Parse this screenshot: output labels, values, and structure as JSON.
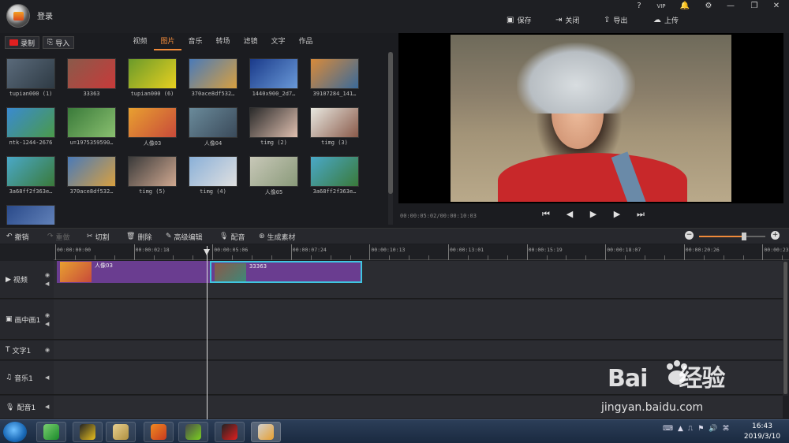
{
  "app": {
    "login_label": "登录",
    "window_buttons": [
      "?",
      "VIP",
      "🔔",
      "⚙",
      "—",
      "❐",
      "✕"
    ],
    "toolbar": [
      {
        "icon": "save-icon",
        "label": "保存"
      },
      {
        "icon": "close-doc-icon",
        "label": "关闭"
      },
      {
        "icon": "export-icon",
        "label": "导出"
      },
      {
        "icon": "upload-icon",
        "label": "上传"
      }
    ]
  },
  "media": {
    "record_label": "录制",
    "import_label": "导入",
    "tabs": [
      {
        "label": "视频",
        "active": false
      },
      {
        "label": "图片",
        "active": true
      },
      {
        "label": "音乐",
        "active": false
      },
      {
        "label": "转场",
        "active": false
      },
      {
        "label": "滤镜",
        "active": false
      },
      {
        "label": "文字",
        "active": false
      },
      {
        "label": "作品",
        "active": false
      }
    ],
    "items": [
      {
        "caption": "tupian000 (1)",
        "colors": [
          "#5a6a7a",
          "#2e3a44"
        ]
      },
      {
        "caption": "33363",
        "colors": [
          "#8a5a4a",
          "#c83a3a"
        ]
      },
      {
        "caption": "tupian000 (6)",
        "colors": [
          "#6a9a2a",
          "#e8d020"
        ]
      },
      {
        "caption": "370ace8df532…",
        "colors": [
          "#4a7ab8",
          "#d8a040"
        ]
      },
      {
        "caption": "1440x900_2d7…",
        "colors": [
          "#1a3a8a",
          "#6a9ad8"
        ]
      },
      {
        "caption": "39107284_141…",
        "colors": [
          "#d88a3a",
          "#3a6a9a"
        ]
      },
      {
        "caption": "ntk-1244-2676",
        "colors": [
          "#3a8ad0",
          "#4a9a4a"
        ]
      },
      {
        "caption": "u=1975359590…",
        "colors": [
          "#3a7a3a",
          "#8ac070"
        ]
      },
      {
        "caption": "人像03",
        "colors": [
          "#e8a030",
          "#c84a3a"
        ]
      },
      {
        "caption": "人像04",
        "colors": [
          "#6a8a9a",
          "#3a4a5a"
        ]
      },
      {
        "caption": "timg (2)",
        "colors": [
          "#2a2a2a",
          "#e0c0b0"
        ]
      },
      {
        "caption": "timg (3)",
        "colors": [
          "#e8e8e0",
          "#8a5a4a"
        ]
      },
      {
        "caption": "3a68ff2f363e…",
        "colors": [
          "#4aa8c8",
          "#3a7a3a"
        ]
      },
      {
        "caption": "370ace8df532…",
        "colors": [
          "#4a7ab8",
          "#d8a040"
        ]
      },
      {
        "caption": "timg (5)",
        "colors": [
          "#3a3a3a",
          "#d0a890"
        ]
      },
      {
        "caption": "timg (4)",
        "colors": [
          "#8ab0d8",
          "#e0e0e0"
        ]
      },
      {
        "caption": "人像05",
        "colors": [
          "#c8c8b8",
          "#8a9a7a"
        ]
      },
      {
        "caption": "3a68ff2f363e…",
        "colors": [
          "#4aa8c8",
          "#3a7a3a"
        ]
      },
      {
        "caption": "",
        "colors": [
          "#2a4a8a",
          "#6a8ac0"
        ]
      }
    ]
  },
  "player": {
    "timecode": "00:00:05:02/00:00:10:03",
    "controls": [
      {
        "name": "skip-start-icon",
        "glyph": "⏮"
      },
      {
        "name": "step-back-icon",
        "glyph": "◀"
      },
      {
        "name": "play-icon",
        "glyph": "▶"
      },
      {
        "name": "step-forward-icon",
        "glyph": "▶"
      },
      {
        "name": "skip-end-icon",
        "glyph": "⏭"
      }
    ]
  },
  "edit_toolbar": {
    "items": [
      {
        "icon": "undo-icon",
        "glyph": "↶",
        "label": "撤销",
        "enabled": true
      },
      {
        "icon": "redo-icon",
        "glyph": "↷",
        "label": "重做",
        "enabled": false
      },
      {
        "icon": "scissors-icon",
        "glyph": "✂",
        "label": "切割",
        "enabled": true
      },
      {
        "icon": "trash-icon",
        "glyph": "🗑",
        "label": "删除",
        "enabled": true
      },
      {
        "icon": "pencil-icon",
        "glyph": "✎",
        "label": "高级编辑",
        "enabled": true
      },
      {
        "icon": "microphone-icon",
        "glyph": "🎙",
        "label": "配音",
        "enabled": true
      },
      {
        "icon": "film-reel-icon",
        "glyph": "⊛",
        "label": "生成素材",
        "enabled": true
      }
    ],
    "zoom_level": 0.68
  },
  "timeline": {
    "ruler_ticks": [
      "00:00:00:00",
      "00:00:02:18",
      "00:00:05:06",
      "00:00:07:24",
      "00:00:10:13",
      "00:00:13:01",
      "00:00:15:19",
      "00:00:18:07",
      "00:00:20:26",
      "00:00:23:"
    ],
    "tracks": [
      {
        "name": "video",
        "icon": "▶",
        "label": "视频",
        "eye": true,
        "audio": true
      },
      {
        "name": "pip",
        "icon": "▣",
        "label": "画中画1",
        "eye": true,
        "audio": true
      },
      {
        "name": "text",
        "icon": "T",
        "label": "文字1",
        "eye": true,
        "audio": false
      },
      {
        "name": "music",
        "icon": "♫",
        "label": "音乐1",
        "eye": false,
        "audio": true
      },
      {
        "name": "dubbing",
        "icon": "🎙",
        "label": "配音1",
        "eye": false,
        "audio": true
      }
    ],
    "clips": [
      {
        "label": "人像03",
        "start_sec": 0,
        "end_sec": 5.06,
        "selected": false,
        "colors": [
          "#e8a030",
          "#c84a3a"
        ]
      },
      {
        "label": "33363",
        "start_sec": 5.06,
        "end_sec": 10.1,
        "selected": true,
        "colors": [
          "#8a5a4a",
          "#3a8a7a"
        ]
      }
    ]
  },
  "taskbar": {
    "apps": [
      {
        "name": "task-app-360",
        "colors": [
          "#7ad070",
          "#1a8a2a"
        ],
        "active": false
      },
      {
        "name": "task-app-qq",
        "colors": [
          "#222",
          "#e8c020"
        ],
        "active": false
      },
      {
        "name": "task-app-explorer",
        "colors": [
          "#e8d090",
          "#b09040"
        ],
        "active": false
      },
      {
        "name": "task-app-firefox",
        "colors": [
          "#f08a20",
          "#c83a20"
        ],
        "active": false
      },
      {
        "name": "task-app-media",
        "colors": [
          "#4a4a4a",
          "#7ad020"
        ],
        "active": false
      },
      {
        "name": "task-app-recorder",
        "colors": [
          "#222",
          "#e02020"
        ],
        "active": false
      },
      {
        "name": "task-app-editor",
        "colors": [
          "#d0d0d0",
          "#e8a030"
        ],
        "active": true
      }
    ],
    "time": "16:43",
    "date": "2019/3/10"
  },
  "watermark": {
    "logo_text": "Bai",
    "logo_text2": "经验",
    "url": "jingyan.baidu.com"
  }
}
